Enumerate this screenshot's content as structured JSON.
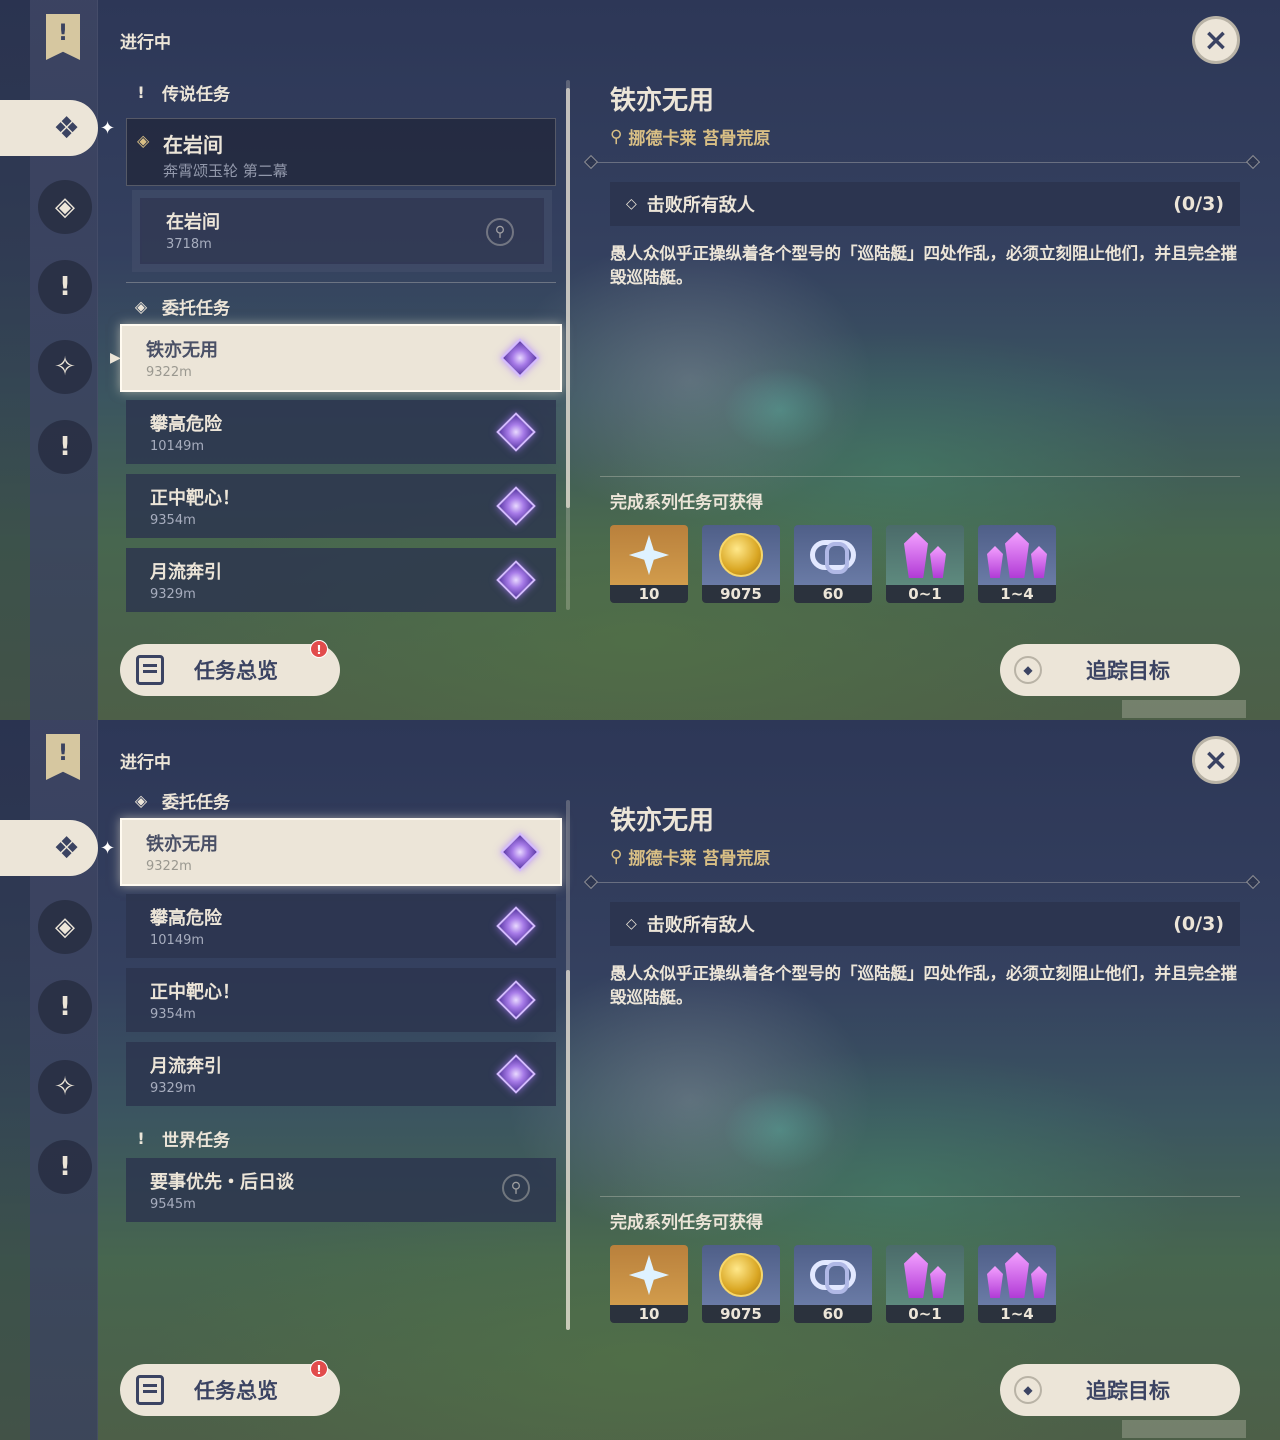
{
  "colors": {
    "panel_dark": "#2c344e",
    "cream": "#ece5d8",
    "gold_text": "#d9bf85",
    "badge_red": "#e24c4c",
    "commission_purple": "#a77be8"
  },
  "shared": {
    "header": "进行中",
    "close_icon": "×",
    "detail": {
      "title": "铁亦无用",
      "location": "挪德卡莱 苔骨荒原",
      "objective": "击败所有敌人",
      "progress": "(0/3)",
      "description": "愚人众似乎正操纵着各个型号的「巡陆艇」四处作乱，必须立刻阻止他们，并且完全摧毁巡陆艇。",
      "rewards_label": "完成系列任务可获得",
      "rewards": [
        {
          "icon": "primogem-icon",
          "count": "10"
        },
        {
          "icon": "mora-icon",
          "count": "9075"
        },
        {
          "icon": "fate-icon",
          "count": "60"
        },
        {
          "icon": "crystal-icon",
          "count": "0~1"
        },
        {
          "icon": "crystal-cluster-icon",
          "count": "1~4"
        }
      ]
    },
    "overview_label": "任务总览",
    "badge": "!",
    "track_label": "追踪目标"
  },
  "screen1": {
    "legend_section": "传说任务",
    "legend_quest": {
      "name": "在岩间",
      "sub": "奔霄颂玉轮 第二幕"
    },
    "legend_sub": {
      "name": "在岩间",
      "dist": "3718m"
    },
    "commission_section": "委托任务",
    "commissions": [
      {
        "name": "铁亦无用",
        "dist": "9322m"
      },
      {
        "name": "攀高危险",
        "dist": "10149m"
      },
      {
        "name": "正中靶心！",
        "dist": "9354m"
      },
      {
        "name": "月流奔引",
        "dist": "9329m"
      }
    ]
  },
  "screen2": {
    "commission_section": "委托任务",
    "commissions": [
      {
        "name": "铁亦无用",
        "dist": "9322m"
      },
      {
        "name": "攀高危险",
        "dist": "10149m"
      },
      {
        "name": "正中靶心！",
        "dist": "9354m"
      },
      {
        "name": "月流奔引",
        "dist": "9329m"
      }
    ],
    "world_section": "世界任务",
    "world_quest": {
      "name": "要事优先・后日谈",
      "dist": "9545m"
    }
  }
}
